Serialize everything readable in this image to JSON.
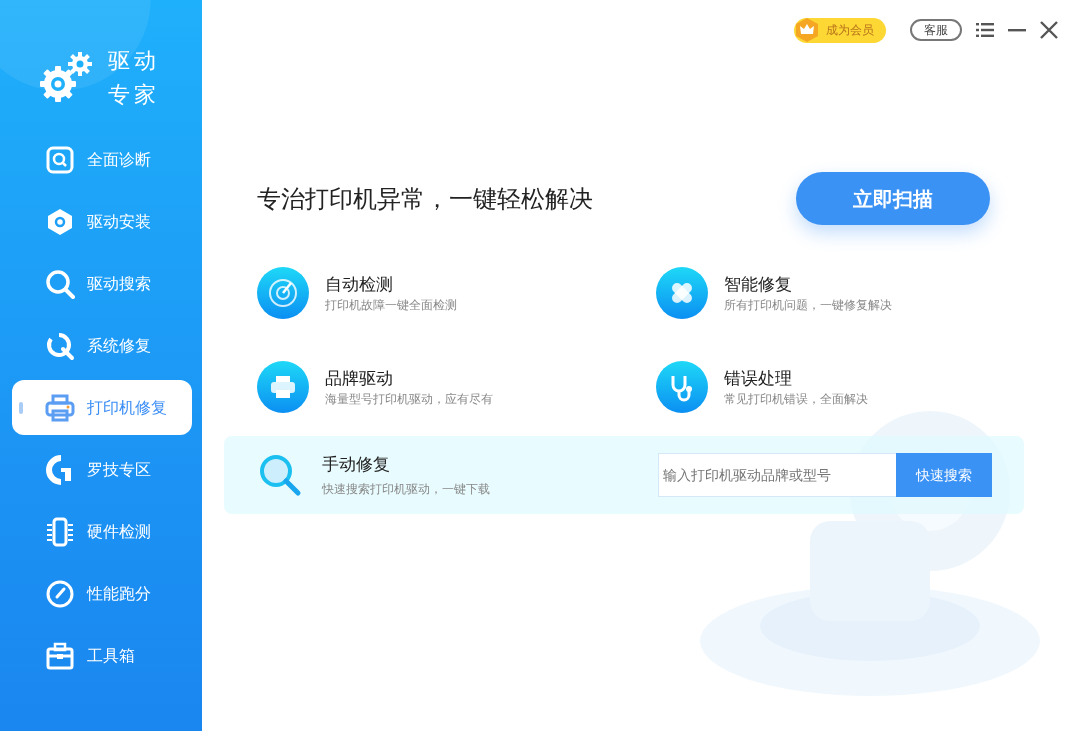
{
  "app": {
    "title_line_1": "驱动",
    "title_line_2": "专家"
  },
  "sidebar": {
    "items": [
      {
        "label": "全面诊断",
        "selected": false
      },
      {
        "label": "驱动安装",
        "selected": false
      },
      {
        "label": "驱动搜索",
        "selected": false
      },
      {
        "label": "系统修复",
        "selected": false
      },
      {
        "label": "打印机修复",
        "selected": true
      },
      {
        "label": "罗技专区",
        "selected": false
      },
      {
        "label": "硬件检测",
        "selected": false
      },
      {
        "label": "性能跑分",
        "selected": false
      },
      {
        "label": "工具箱",
        "selected": false
      }
    ]
  },
  "top_bar": {
    "member_button": "成为会员",
    "service_button": "客服"
  },
  "main": {
    "headline": "专治打印机异常，一键轻松解决",
    "scan_button": "立即扫描",
    "features": [
      {
        "title": "自动检测",
        "description": "打印机故障一键全面检测"
      },
      {
        "title": "智能修复",
        "description": "所有打印机问题，一键修复解决"
      },
      {
        "title": "品牌驱动",
        "description": "海量型号打印机驱动，应有尽有"
      },
      {
        "title": "错误处理",
        "description": "常见打印机错误，全面解决"
      }
    ],
    "manual_repair": {
      "title": "手动修复",
      "description": "快速搜索打印机驱动，一键下载",
      "search_placeholder": "输入打印机驱动品牌或型号",
      "search_button": "快速搜索"
    }
  }
}
